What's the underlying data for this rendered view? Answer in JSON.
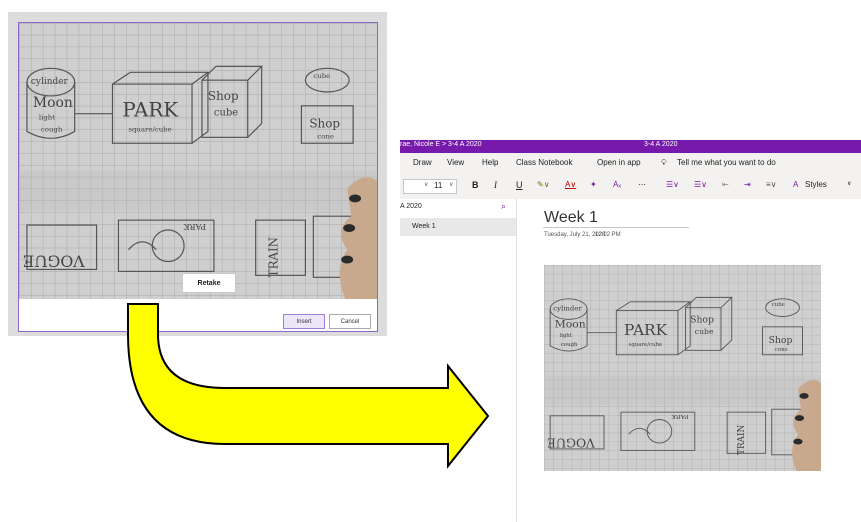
{
  "capture": {
    "retake_label": "Retake",
    "insert_label": "Insert",
    "cancel_label": "Cancel",
    "sketch_texts": [
      "cylinder",
      "Moon",
      "light",
      "cough",
      "PARK",
      "square/cube",
      "Shop",
      "cube",
      "shop",
      "cube",
      "Shop",
      "cone",
      "cube",
      "pyramid",
      "VOGUE",
      "PARK",
      "TRAIN"
    ]
  },
  "onenote": {
    "breadcrumb": "rae, Nicole E > 3-4 A 2020",
    "notebook": "3-4 A 2020",
    "menu": [
      "Draw",
      "View",
      "Help",
      "Class Notebook",
      "Open in app"
    ],
    "tell_me": "Tell me what you want to do",
    "font_size": "11",
    "styles_label": "Styles",
    "section_name": "A 2020",
    "pages": [
      "Week 1"
    ],
    "page": {
      "title": "Week 1",
      "date": "Tuesday, July 21, 2020",
      "time": "12:02 PM"
    }
  },
  "colors": {
    "accent": "#7719aa",
    "arrow_fill": "#ffff00",
    "insert_bg": "#ede6f8"
  }
}
